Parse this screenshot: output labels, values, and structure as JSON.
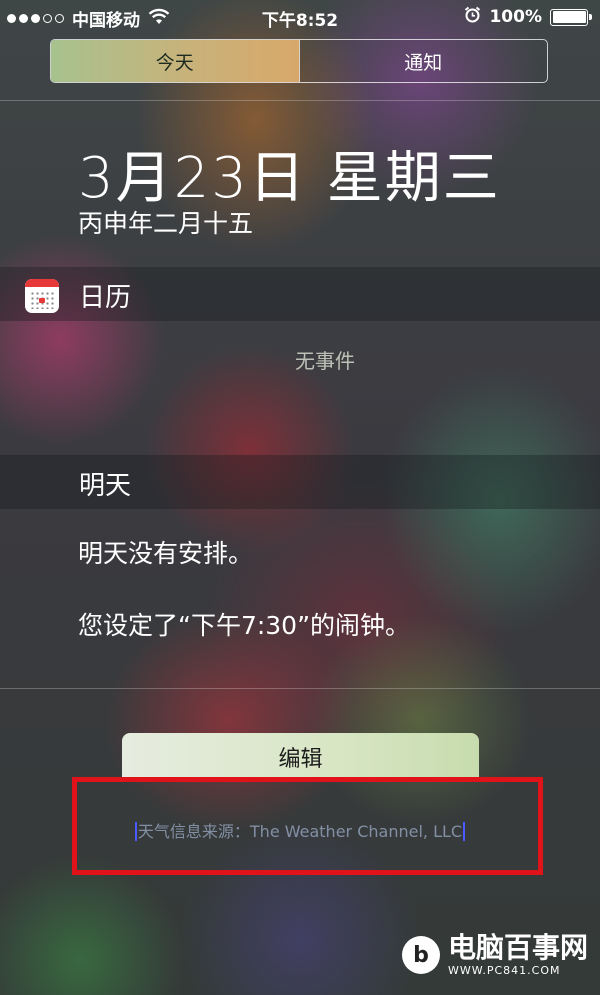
{
  "status_bar": {
    "carrier": "中国移动",
    "time": "下午8:52",
    "battery": "100%",
    "signal_full": 3,
    "signal_total": 5,
    "battery_level": 1.0
  },
  "tabs": [
    {
      "label": "今天",
      "active": true
    },
    {
      "label": "通知",
      "active": false
    }
  ],
  "date": {
    "main": "3月23日 星期三",
    "lunar": "丙申年二月十五"
  },
  "calendar": {
    "title": "日历",
    "empty": "无事件"
  },
  "tomorrow": {
    "title": "明天",
    "line1": "明天没有安排。",
    "line2": "您设定了“下午7:30”的闹钟。"
  },
  "edit_label": "编辑",
  "weather_source": "天气信息来源：The Weather Channel, LLC",
  "watermark": {
    "title": "电脑百事网",
    "url": "WWW.PC841.COM"
  },
  "colors": {
    "active_tab": "#c8b27a",
    "highlight_border": "#e0121a",
    "calendar_red": "#e8393a"
  },
  "icons": [
    "signal-dots",
    "wifi-icon",
    "alarm-icon",
    "battery-icon",
    "calendar-icon"
  ]
}
